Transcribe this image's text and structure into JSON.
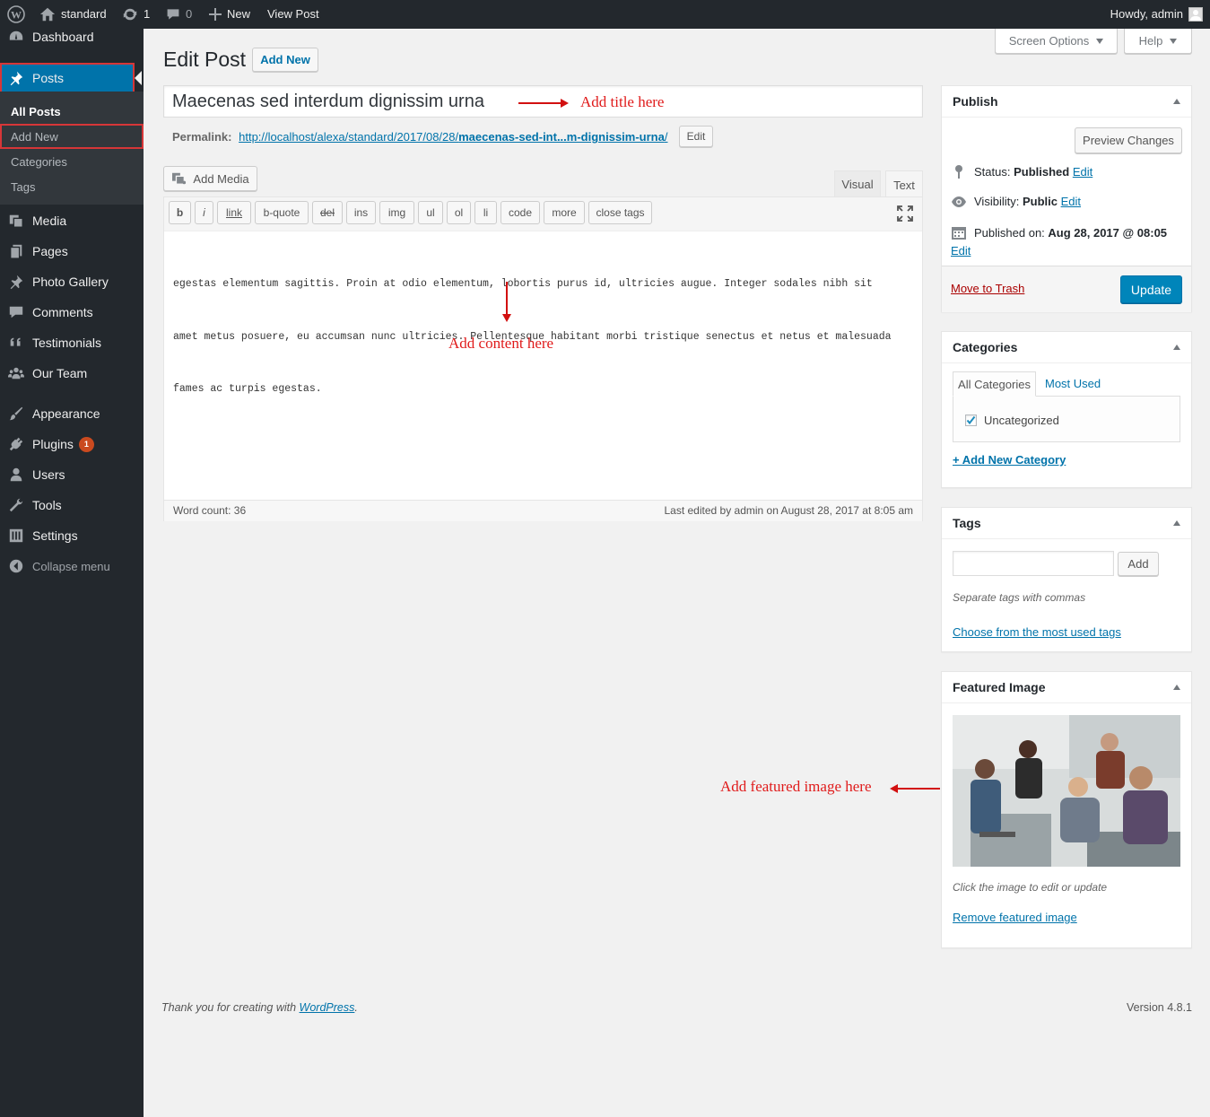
{
  "adminbar": {
    "site_name": "standard",
    "updates_count": "1",
    "comments_count": "0",
    "new_label": "New",
    "view_post_label": "View Post",
    "howdy": "Howdy, admin"
  },
  "sidebar": {
    "items": [
      {
        "label": "Dashboard"
      },
      {
        "label": "Posts"
      },
      {
        "label": "Media"
      },
      {
        "label": "Pages"
      },
      {
        "label": "Photo Gallery"
      },
      {
        "label": "Comments"
      },
      {
        "label": "Testimonials"
      },
      {
        "label": "Our Team"
      },
      {
        "label": "Appearance"
      },
      {
        "label": "Plugins",
        "badge": "1"
      },
      {
        "label": "Users"
      },
      {
        "label": "Tools"
      },
      {
        "label": "Settings"
      },
      {
        "label": "Collapse menu"
      }
    ],
    "submenu": [
      "All Posts",
      "Add New",
      "Categories",
      "Tags"
    ]
  },
  "header": {
    "title": "Edit Post",
    "add_new": "Add New",
    "screen_options": "Screen Options",
    "help": "Help"
  },
  "editor": {
    "post_title": "Maecenas sed interdum dignissim urna",
    "permalink_label": "Permalink:",
    "permalink_prefix": "http://localhost/alexa/standard/2017/08/28/",
    "permalink_slug": "maecenas-sed-int...m-dignissim-urna",
    "permalink_suffix": "/",
    "permalink_edit": "Edit",
    "add_media": "Add Media",
    "tab_visual": "Visual",
    "tab_text": "Text",
    "quicktags": [
      "b",
      "i",
      "link",
      "b-quote",
      "del",
      "ins",
      "img",
      "ul",
      "ol",
      "li",
      "code",
      "more",
      "close tags"
    ],
    "content_lines": [
      "egestas elementum sagittis. Proin at odio elementum, lobortis purus id, ultricies augue. Integer sodales nibh sit",
      "amet metus posuere, eu accumsan nunc ultricies. Pellentesque habitant morbi tristique senectus et netus et malesuada",
      "fames ac turpis egestas."
    ],
    "word_count": "Word count: 36",
    "last_edited": "Last edited by admin on August 28, 2017 at 8:05 am"
  },
  "annotations": {
    "title": "Add title here",
    "content": "Add content here",
    "featured": "Add featured image here"
  },
  "publish": {
    "title": "Publish",
    "preview": "Preview Changes",
    "status_label": "Status: ",
    "status_value": "Published",
    "visibility_label": "Visibility: ",
    "visibility_value": "Public",
    "published_label": "Published on: ",
    "published_value": "Aug 28, 2017 @ 08:05",
    "edit": "Edit",
    "trash": "Move to Trash",
    "update": "Update"
  },
  "categories": {
    "title": "Categories",
    "tab_all": "All Categories",
    "tab_most": "Most Used",
    "item": "Uncategorized",
    "add_new": "+ Add New Category"
  },
  "tags": {
    "title": "Tags",
    "add": "Add",
    "hint": "Separate tags with commas",
    "choose": "Choose from the most used tags"
  },
  "featured": {
    "title": "Featured Image",
    "hint": "Click the image to edit or update",
    "remove": "Remove featured image"
  },
  "footer": {
    "thanks_prefix": "Thank you for creating with ",
    "wp_link": "WordPress",
    "thanks_suffix": ".",
    "version": "Version 4.8.1"
  },
  "colors": {
    "accent": "#0073aa",
    "sidebar_bg": "#23282d",
    "annotation": "#e01b1b",
    "highlight_box": "#d63638"
  }
}
